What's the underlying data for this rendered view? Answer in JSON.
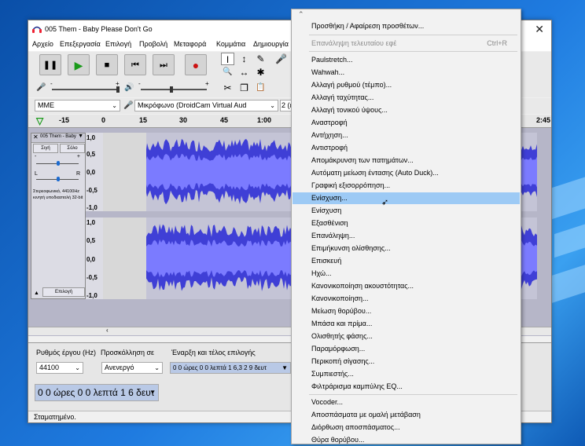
{
  "window": {
    "title": "005 Them - Baby Please Don't Go",
    "close": "✕"
  },
  "menubar": [
    "Αρχείο",
    "Επεξεργασία",
    "Επιλογή",
    "Προβολή",
    "Μεταφορά",
    "Κομμάτια",
    "Δημιουργία"
  ],
  "transport": {
    "pause": "❚❚",
    "play": "▶",
    "stop": "■",
    "skip_start": "⏮",
    "skip_end": "⏭",
    "record": "●"
  },
  "tools": {
    "select": "I",
    "envelope": "↕",
    "draw": "✎",
    "zoom": "🔍",
    "timeshift": "↔",
    "multi": "✱",
    "cut": "✂",
    "copy": "❐",
    "paste": "📋"
  },
  "meters": {
    "input_icon": "🎤",
    "output_icon": "🔊",
    "minus": "-",
    "plus": "+"
  },
  "devices": {
    "host": "MME",
    "mic_device": "Μικρόφωνο (DroidCam Virtual Aud",
    "channels": "2 (ε"
  },
  "ruler": {
    "ticks": [
      "-15",
      "0",
      "15",
      "30",
      "45",
      "1:00"
    ],
    "end": "2:45"
  },
  "track": {
    "name": "005 Them - Baby",
    "mute": "Σιγή",
    "solo": "Σόλο",
    "minus": "-",
    "plus": "+",
    "left": "L",
    "right": "R",
    "info": "Στερεοφωνικό, 44100Hz\nκινητή υποδιαστολή 32-bit",
    "select_button": "Επιλογή",
    "collapse": "▲",
    "scale_top": [
      "1,0",
      "0,5",
      "0,0",
      "-0,5",
      "-1,0"
    ],
    "scale_bottom": [
      "1,0",
      "0,5",
      "0,0",
      "-0,5",
      "-1,0"
    ]
  },
  "selection_bar": {
    "rate_label": "Ρυθμός έργου (Hz)",
    "snap_label": "Προσκόλληση σε",
    "range_label": "Έναρξη και τέλος επιλογής",
    "rate_value": "44100",
    "snap_value": "Ανενεργό",
    "start_value": "0 0 ώρες 0 0 λεπτά 1 6,3 2 9 δευτ",
    "position_value": "0 0 ώρες 0 0 λεπτά 1 6 δευτ"
  },
  "status": "Σταματημένο.",
  "effects_menu": {
    "top_arrow": "⌃",
    "items": [
      {
        "label": "Προσθήκη / Αφαίρεση προσθέτων...",
        "disabled": false
      },
      {
        "label": "Επανάληψη τελευταίου εφέ",
        "shortcut": "Ctrl+R",
        "disabled": true
      },
      {
        "label": "Paulstretch...",
        "disabled": false
      },
      {
        "label": "Wahwah...",
        "disabled": false
      },
      {
        "label": "Αλλαγή ρυθμού (τέμπο)...",
        "disabled": false
      },
      {
        "label": "Αλλαγή ταχύτητας...",
        "disabled": false
      },
      {
        "label": "Αλλαγή τονικού ύψους...",
        "disabled": false
      },
      {
        "label": "Αναστροφή",
        "disabled": false
      },
      {
        "label": "Αντήχηση...",
        "disabled": false
      },
      {
        "label": "Αντιστροφή",
        "disabled": false
      },
      {
        "label": "Απομάκρυνση των πατημάτων...",
        "disabled": false
      },
      {
        "label": "Αυτόματη μείωση έντασης (Auto Duck)...",
        "disabled": false
      },
      {
        "label": "Γραφική εξισορρόπηση...",
        "disabled": false
      },
      {
        "label": "Ενίσχυση...",
        "disabled": false,
        "highlighted": true
      },
      {
        "label": "Ενίσχυση",
        "disabled": false
      },
      {
        "label": "Εξασθένιση",
        "disabled": false
      },
      {
        "label": "Επανάληψη...",
        "disabled": false
      },
      {
        "label": "Επιμήκυνση ολίσθησης...",
        "disabled": false
      },
      {
        "label": "Επισκευή",
        "disabled": false
      },
      {
        "label": "Ηχώ...",
        "disabled": false
      },
      {
        "label": "Κανονικοποίηση ακουστότητας...",
        "disabled": false
      },
      {
        "label": "Κανονικοποίηση...",
        "disabled": false
      },
      {
        "label": "Μείωση θορύβου...",
        "disabled": false
      },
      {
        "label": "Μπάσα και πρίμα...",
        "disabled": false
      },
      {
        "label": "Ολισθητής φάσης...",
        "disabled": false
      },
      {
        "label": "Παραμόρφωση...",
        "disabled": false
      },
      {
        "label": "Περικοπή σίγασης...",
        "disabled": false
      },
      {
        "label": "Συμπιεστής...",
        "disabled": false
      },
      {
        "label": "Φιλτράρισμα καμπύλης EQ...",
        "disabled": false
      },
      {
        "label": "Vocoder...",
        "disabled": false
      },
      {
        "label": "Αποσπάσματα με ομαλή μετάβαση",
        "disabled": false
      },
      {
        "label": "Διόρθωση αποσπάσματος...",
        "disabled": false
      },
      {
        "label": "Θύρα θορύβου...",
        "disabled": false
      }
    ]
  },
  "colors": {
    "waveform": "#3f3fd6",
    "waveform_light": "#7b7bff",
    "menu_highlight": "#9dcaf5",
    "record": "#cc1111",
    "play": "#1a9a1a"
  }
}
